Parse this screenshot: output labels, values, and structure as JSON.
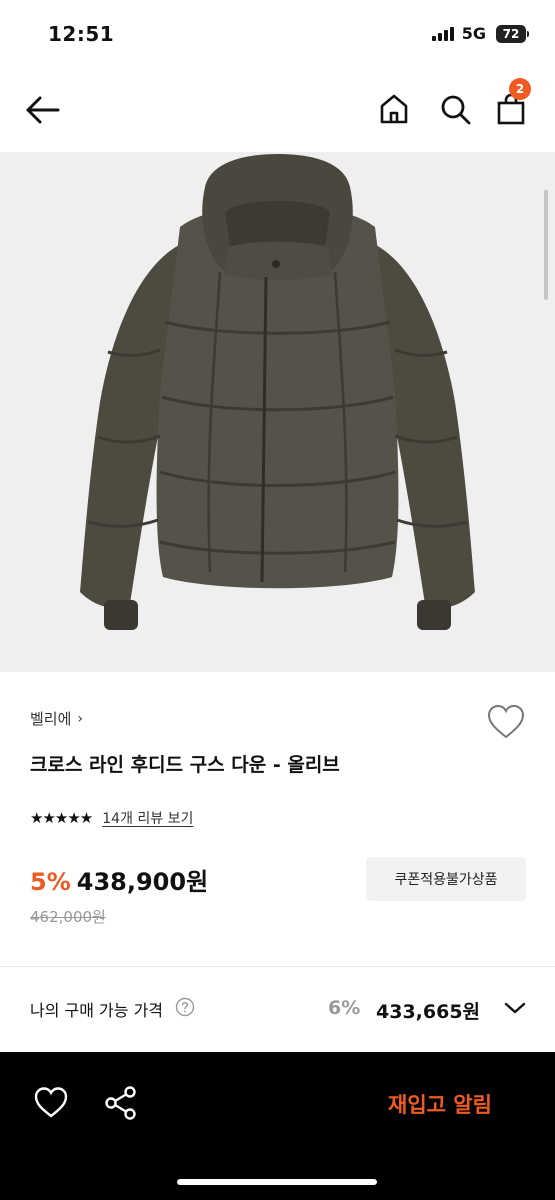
{
  "status": {
    "time": "12:51",
    "network": "5G",
    "battery": "72"
  },
  "nav": {
    "cart_count": "2"
  },
  "product": {
    "brand": "벨리에",
    "brand_chevron": "›",
    "title": "크로스 라인 후디드 구스 다운 - 올리브",
    "stars": "★★★★★",
    "review_link": "14개 리뷰 보기",
    "discount": "5%",
    "price": "438,900원",
    "original_price": "462,000원",
    "coupon_label": "쿠폰적용불가상품"
  },
  "my_price": {
    "label": "나의 구매 가능 가격",
    "discount": "6%",
    "price": "433,665원"
  },
  "bottom": {
    "restock_label": "재입고 알림"
  },
  "colors": {
    "accent": "#f15a22",
    "jacket": "#4d4a40",
    "image_bg": "#efefef"
  },
  "icons": [
    "back-arrow-icon",
    "home-icon",
    "search-icon",
    "bag-icon",
    "heart-outline-icon",
    "help-icon",
    "chevron-down-icon",
    "share-icon"
  ]
}
